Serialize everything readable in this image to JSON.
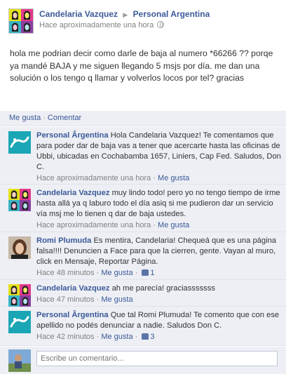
{
  "post": {
    "author": "Candelaria Vazquez",
    "target": "Personal Argentina",
    "timestamp": "Hace aproximadamente una hora",
    "text": "hola me podrian decir como darle de baja al numero *66266 ?? porqe ya mandé BAJA y me siguen llegando 5 msjs por día. me dan una solución o los tengo q llamar y volverlos locos por tel? gracias"
  },
  "actions": {
    "like": "Me gusta",
    "comment": "Comentar"
  },
  "comments": [
    {
      "author": "Personal Ârgentina",
      "text": "Hola Candelaria Vazquez! Te comentamos que para poder dar de baja vas a tener que acercarte hasta las oficinas de Ubbi, ubicadas en Cochabamba 1657, Liniers, Cap Fed. Saludos, Don C.",
      "time": "Hace aproximadamente una hora",
      "like": "Me gusta"
    },
    {
      "author": "Candelaria Vazquez",
      "text": "muy lindo todo! pero yo no tengo tiempo de irme hasta allá ya q laburo todo el día asiq si me pudieron dar un servicio vía msj me lo tienen q dar de baja ustedes.",
      "time": "Hace aproximadamente una hora",
      "like": "Me gusta"
    },
    {
      "author": "Romi Plumuda",
      "text": "Es mentira, Candelaria! Chequeá que es una página falsa!!!! Denuncien a Face para que la cierren, gente. Vayan al muro, click en Mensaje, Reportar Página.",
      "time": "Hace 48 minutos",
      "like": "Me gusta",
      "likes": "1"
    },
    {
      "author": "Candelaria Vazquez",
      "text": "ah me parecía! graciasssssss",
      "time": "Hace 47 minutos",
      "like": "Me gusta"
    },
    {
      "author": "Personal Ârgentina",
      "text": "Que tal Romi Plumuda! Te comento que con ese apellido no podés denunciar a nadie. Saludos Don C.",
      "time": "Hace 42 minutos",
      "like": "Me gusta",
      "likes": "3"
    }
  ],
  "write": {
    "placeholder": "Escribe un comentario..."
  },
  "colors": {
    "link": "#3b5998",
    "panel": "#edeff4",
    "input_border": "#bdc7d8"
  }
}
